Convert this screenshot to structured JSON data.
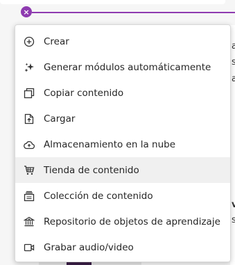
{
  "insert_button": {
    "symbol": "×"
  },
  "background_fragments": [
    "a",
    "s",
    "a",
    "v",
    "s"
  ],
  "menu": {
    "items": [
      {
        "label": "Crear",
        "icon": "plus-circle-icon"
      },
      {
        "label": "Generar módulos automáticamente",
        "icon": "sparkle-icon"
      },
      {
        "label": "Copiar contenido",
        "icon": "copy-icon"
      },
      {
        "label": "Cargar",
        "icon": "upload-file-icon"
      },
      {
        "label": "Almacenamiento en la nube",
        "icon": "cloud-upload-icon"
      },
      {
        "label": "Tienda de contenido",
        "icon": "cart-icon"
      },
      {
        "label": "Colección de contenido",
        "icon": "collection-icon"
      },
      {
        "label": "Repositorio de objetos de aprendizaje",
        "icon": "institution-icon"
      },
      {
        "label": "Grabar audio/video",
        "icon": "video-camera-icon"
      }
    ]
  },
  "colors": {
    "accent": "#8e3bb0",
    "hover": "#f0f0f0",
    "text": "#262626"
  }
}
